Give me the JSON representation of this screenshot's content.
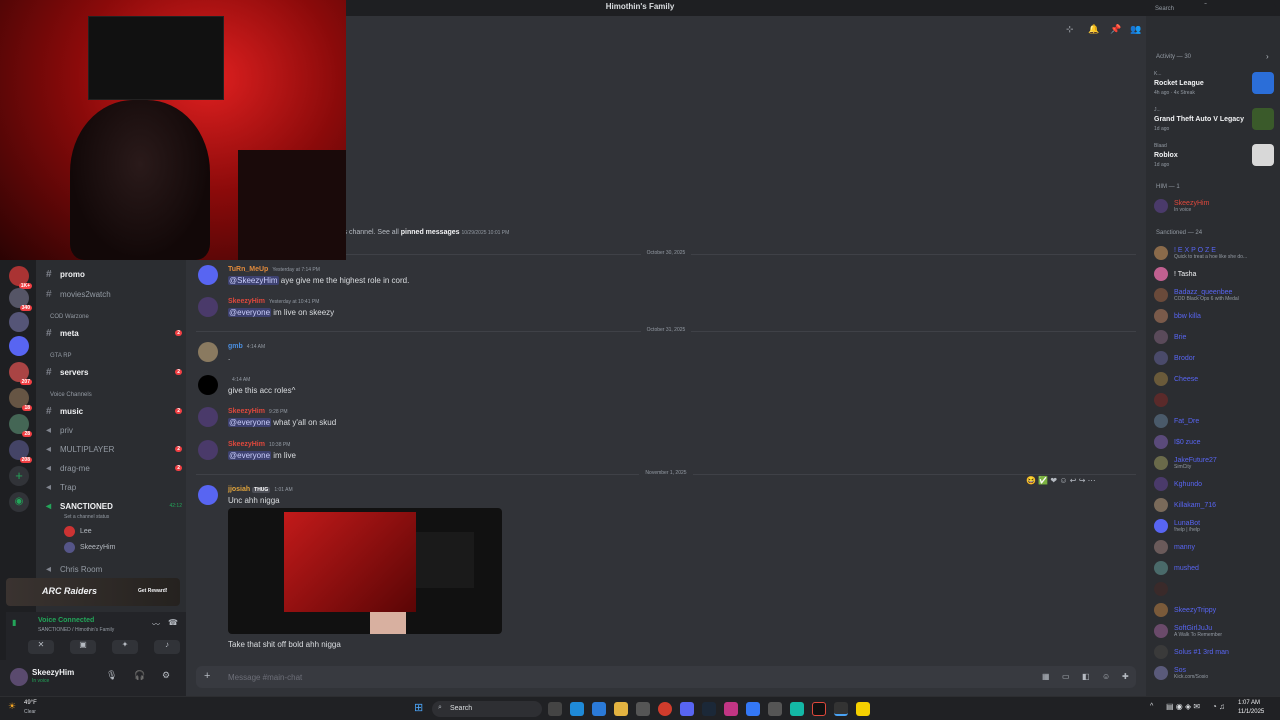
{
  "window": {
    "title": "Himothin's Family"
  },
  "header_search_placeholder": "Search",
  "rail_badges": [
    "1K+",
    "340",
    "207",
    "18",
    "28",
    "208"
  ],
  "sidebar": {
    "channels_top": [
      {
        "label": "promo",
        "bright": true
      },
      {
        "label": "movies2watch",
        "bright": false
      }
    ],
    "cat_warzone": "COD Warzone",
    "meta": {
      "label": "meta",
      "count": "2"
    },
    "cat_gta": "GTA RP",
    "servers": {
      "label": "servers",
      "count": "2"
    },
    "cat_voice": "Voice Channels",
    "voice": [
      {
        "label": "music",
        "count": "2"
      },
      {
        "label": "priv"
      },
      {
        "label": "MULTIPLAYER",
        "count": "2"
      },
      {
        "label": "drag-me",
        "count": "2"
      },
      {
        "label": "Trap"
      }
    ],
    "sanctioned": {
      "label": "SANCTIONED",
      "timer": "42:12",
      "status": "Set a channel status"
    },
    "voice_users": [
      "Lee",
      "SkeezyHim"
    ],
    "chris": "Chris Room",
    "promo_banner": {
      "brand": "ARC Raiders",
      "button": "Get Reward!"
    },
    "voice_connected": {
      "title": "Voice Connected",
      "sub": "SANCTIONED / Himothin's Family"
    },
    "user": {
      "name": "SkeezyHim",
      "status": "In voice"
    }
  },
  "chat": {
    "pinned_prefix": "is channel. See all",
    "pinned_link": "pinned messages",
    "pinned_time": "10/29/2025 10:01 PM",
    "dates": [
      "October 30, 2025",
      "October 31, 2025",
      "November 1, 2025"
    ],
    "messages": [
      {
        "name": "TuRn_MeUp",
        "time": "Yesterday at 7:14 PM",
        "mention": "@SkeezyHim",
        "text": " aye give me the highest role in cord.",
        "color": "#e08a3c"
      },
      {
        "name": "SkeezyHim",
        "time": "Yesterday at 10:41 PM",
        "mention": "@everyone",
        "text": " im live on skeezy",
        "color": "#e0483c"
      },
      {
        "name": "gmb",
        "time": "4:14 AM",
        "mention": "",
        "text": ".",
        "color": "#4a8ee0"
      },
      {
        "name": "",
        "time": "4:14 AM",
        "mention": "",
        "text": "give this acc roles^",
        "color": "#e0483c"
      },
      {
        "name": "SkeezyHim",
        "time": "9:28 PM",
        "mention": "@everyone",
        "text": " what y'all on skud",
        "color": "#e0483c"
      },
      {
        "name": "SkeezyHim",
        "time": "10:38 PM",
        "mention": "@everyone",
        "text": " im live",
        "color": "#e0483c"
      },
      {
        "name": "jjosiah",
        "tag": "THUG",
        "time": "1:01 AM",
        "mention": "",
        "text": "Unc ahh nigga",
        "color": "#e0a43c"
      }
    ],
    "after_image": "Take that shit off bold ahh nigga",
    "input_placeholder": "Message #main-chat"
  },
  "right": {
    "search": "Search",
    "activity_header": "Activity — 30",
    "activities": [
      {
        "who": "K...",
        "game": "Rocket League",
        "meta": "4h ago · 4x Streak"
      },
      {
        "who": "J...",
        "game": "Grand Theft Auto V Legacy",
        "meta": "1d ago"
      },
      {
        "who": "Blaad",
        "game": "Roblox",
        "meta": "1d ago"
      }
    ],
    "him_header": "HIM — 1",
    "him": [
      {
        "name": "SkeezyHim",
        "sub": "In voice",
        "color": "#e0483c"
      }
    ],
    "sanctioned_header": "Sanctioned — 24",
    "members": [
      {
        "name": "! E X P O Z E",
        "sub": "Quick to treat a hoe like she do...",
        "color": "#5865f2"
      },
      {
        "name": "! Tasha",
        "sub": "",
        "color": "#f2f3f5"
      },
      {
        "name": "Badazz_queenbee",
        "sub": "COD Black Ops 6 with Medal",
        "color": "#5865f2"
      },
      {
        "name": "bbw killa",
        "sub": "",
        "color": "#5865f2"
      },
      {
        "name": "Brie",
        "sub": "",
        "color": "#5865f2"
      },
      {
        "name": "Brodor",
        "sub": "",
        "color": "#5865f2"
      },
      {
        "name": "Cheese",
        "sub": "",
        "color": "#5865f2"
      },
      {
        "name": "",
        "sub": "",
        "color": "#e0483c"
      },
      {
        "name": "Fat_Dre",
        "sub": "",
        "color": "#5865f2"
      },
      {
        "name": "I$0 zuce",
        "sub": "",
        "color": "#5865f2"
      },
      {
        "name": "JakeFuture27",
        "sub": "SimCity",
        "color": "#5865f2"
      },
      {
        "name": "Kghundo",
        "sub": "",
        "color": "#5865f2"
      },
      {
        "name": "Killakam_716",
        "sub": "",
        "color": "#5865f2"
      },
      {
        "name": "LunaBot",
        "sub": "!help | /help",
        "color": "#5865f2"
      },
      {
        "name": "manny",
        "sub": "",
        "color": "#5865f2"
      },
      {
        "name": "mushed",
        "sub": "",
        "color": "#5865f2"
      },
      {
        "name": "",
        "sub": "",
        "color": "#e0483c"
      },
      {
        "name": "SkeezyTrippy",
        "sub": "",
        "color": "#5865f2"
      },
      {
        "name": "SoftGirlJuJu",
        "sub": "A Walk To Remember",
        "color": "#5865f2"
      },
      {
        "name": "Solus #1 3rd man",
        "sub": "",
        "color": "#5865f2"
      },
      {
        "name": "Sos",
        "sub": "Kick.com/Sosio",
        "color": "#5865f2"
      }
    ]
  },
  "taskbar": {
    "weather_temp": "49°F",
    "weather_desc": "Clear",
    "search": "Search",
    "time": "1:07 AM",
    "date": "11/1/2025"
  }
}
